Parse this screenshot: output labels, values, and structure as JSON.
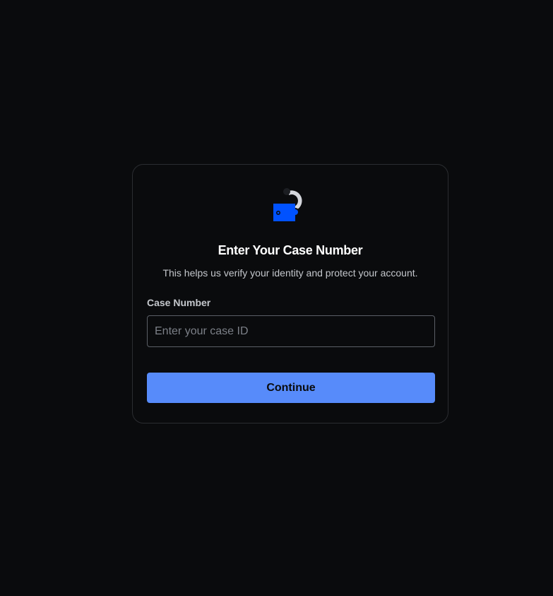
{
  "logo": {
    "icon": "wallet-question-icon",
    "colors": {
      "primary": "#0052ff",
      "secondary": "#d4d6dc"
    }
  },
  "card": {
    "title": "Enter Your Case Number",
    "subtitle": "This helps us verify your identity and protect your account.",
    "field_label": "Case Number",
    "input": {
      "value": "",
      "placeholder": "Enter your case ID"
    },
    "continue_label": "Continue"
  },
  "colors": {
    "background": "#0a0b0d",
    "accent": "#578bfa",
    "card_border": "#2b2d31"
  }
}
